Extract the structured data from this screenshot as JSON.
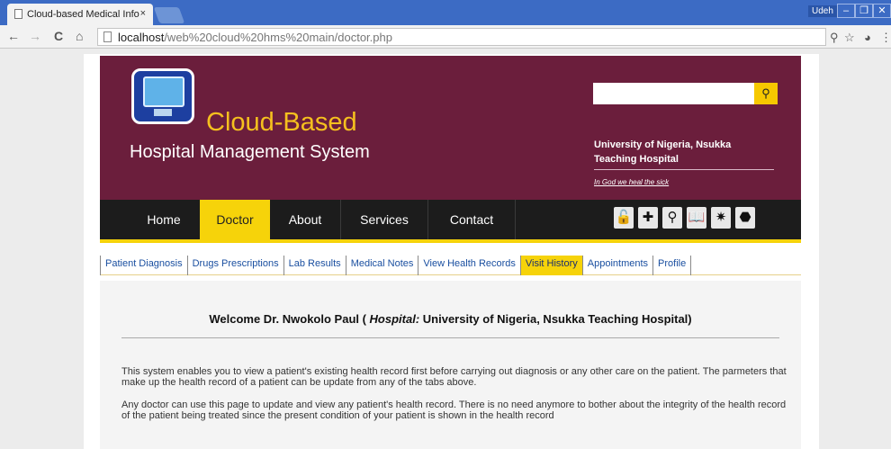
{
  "browser": {
    "tab_title": "Cloud-based Medical Info",
    "tab_close": "×",
    "user": "Udeh",
    "win_buttons": [
      "–",
      "❐",
      "✕"
    ],
    "url_host": "localhost",
    "url_path": "/web%20cloud%20hms%20main/doctor.php",
    "nav_icons": [
      "←",
      "→",
      "C",
      "⌂"
    ],
    "ext_icons": [
      "⚲",
      "☆",
      "◕",
      "⋮"
    ]
  },
  "header": {
    "title_line1": "Cloud-Based",
    "title_line2": "Hospital Management System",
    "search_placeholder": "",
    "search_icon": "search-icon",
    "search_glyph": "⚲",
    "university_line1": "University of Nigeria, Nsukka",
    "university_line2": "Teaching Hospital",
    "motto": "In God we heal the sick"
  },
  "menu": {
    "items": [
      "Home",
      "Doctor",
      "About",
      "Services",
      "Contact"
    ],
    "active": "Doctor",
    "icon_glyphs": [
      "🔓",
      "✚",
      "⚲",
      "📖",
      "✷",
      "⬣"
    ],
    "icon_names": [
      "unlock-icon",
      "medical-cross-icon",
      "search-icon",
      "book-icon",
      "gear-icon",
      "badge-icon"
    ]
  },
  "subtabs": {
    "items": [
      "Patient Diagnosis",
      "Drugs Prescriptions",
      "Lab Results",
      "Medical Notes",
      "View Health Records",
      "Visit History",
      "Appointments",
      "Profile"
    ],
    "active": "Visit History"
  },
  "content": {
    "welcome_prefix": "Welcome Dr. Nwokolo Paul ( ",
    "hospital_label": "Hospital:",
    "welcome_suffix": " University of Nigeria, Nsukka Teaching Hospital)",
    "para1": "This system enables you to view a patient's existing health record first before carrying out diagnosis or any other care on the patient. The parmeters that make up the health record of a patient can be update from any of the tabs above.",
    "para2": "Any doctor can use this page to update and view any patient's health record. There is no need anymore to bother about the integrity of the health record of the patient being treated since the present condition of your patient is shown in the health record"
  },
  "colors": {
    "banner": "#6b1e3c",
    "accent": "#f6d30a",
    "title": "#f5c01e",
    "menubar": "#1c1c1c",
    "link": "#1a4fa0"
  }
}
